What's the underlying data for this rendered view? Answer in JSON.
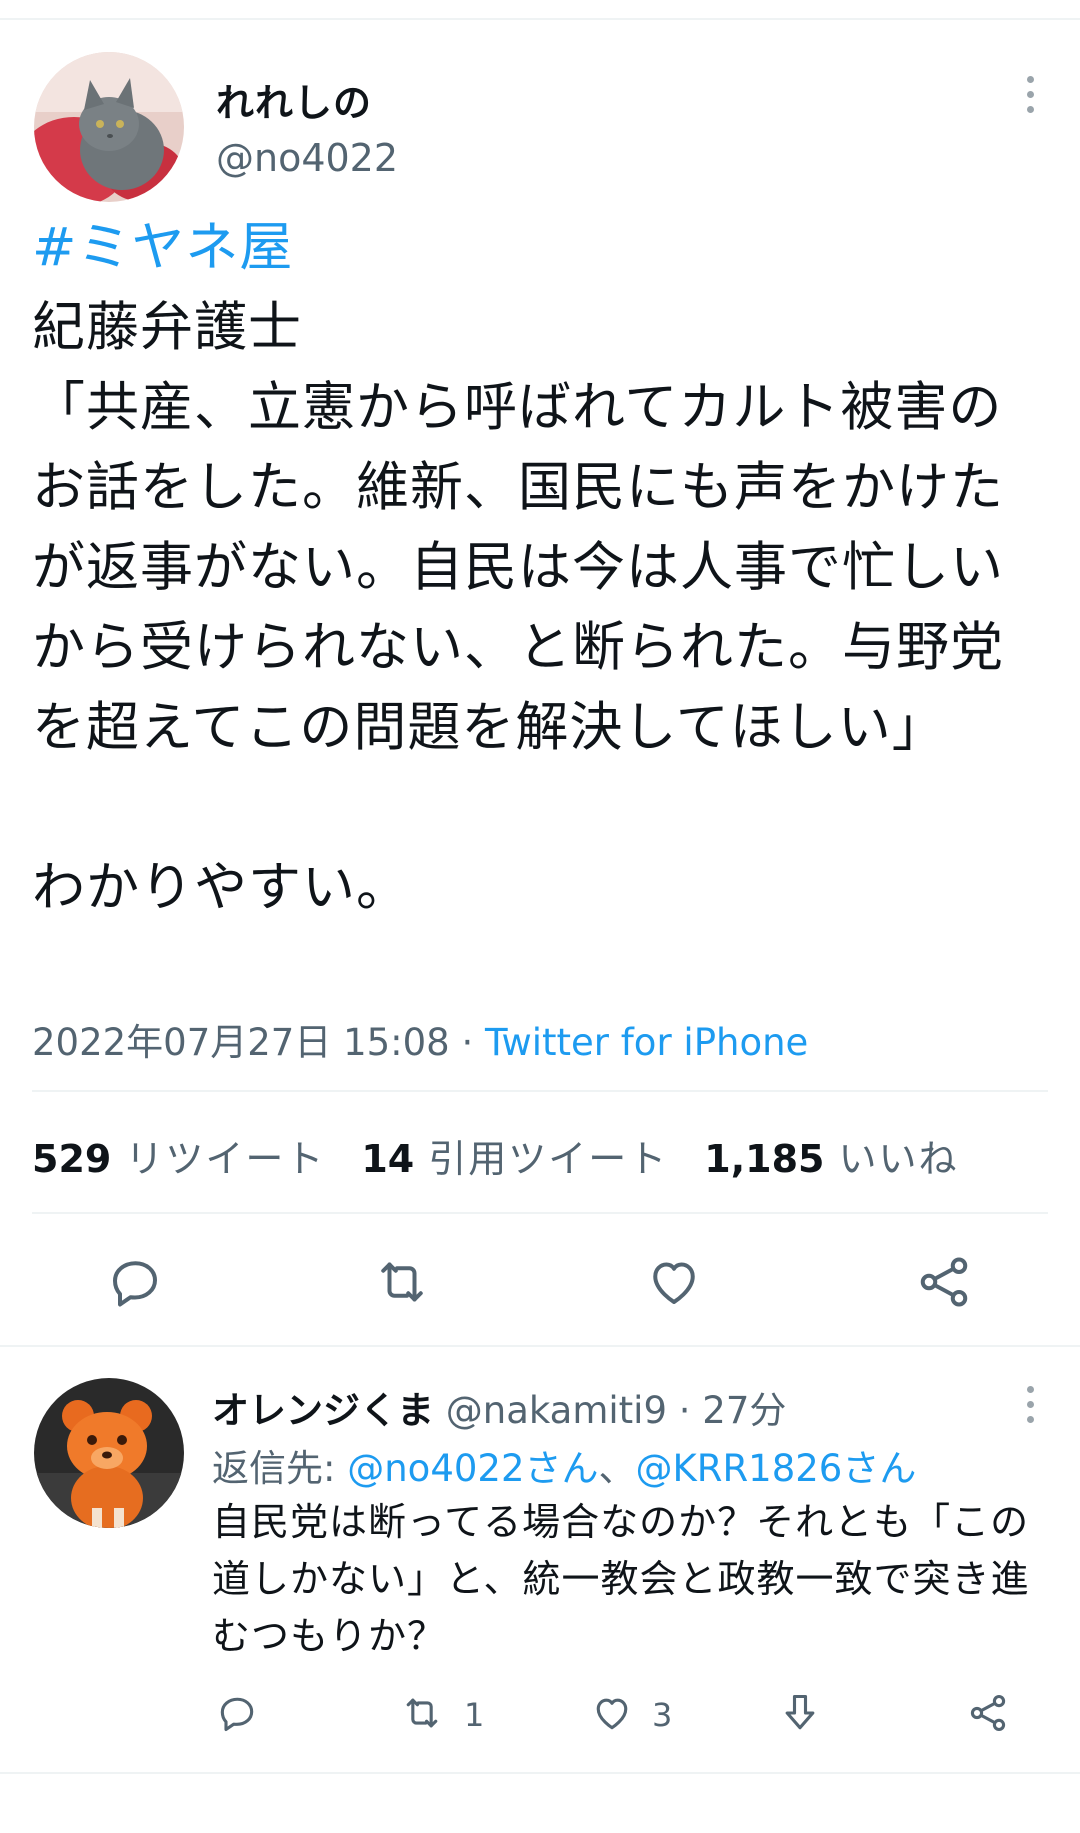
{
  "tweet": {
    "display_name": "れれしの",
    "handle": "@no4022",
    "hashtag": "#ミヤネ屋",
    "body": "紀藤弁護士\n「共産、立憲から呼ばれてカルト被害のお話をした。維新、国民にも声をかけたが返事がない。自民は今は人事で忙しいから受けられない、と断られた。与野党を超えてこの問題を解決してほしい」\n\nわかりやすい。",
    "timestamp": "2022年07月27日 15:08",
    "separator": " · ",
    "source": "Twitter for iPhone",
    "stats": {
      "retweets_count": "529",
      "retweets_label": "リツイート",
      "quotes_count": "14",
      "quotes_label": "引用ツイート",
      "likes_count": "1,185",
      "likes_label": "いいね"
    },
    "icons": [
      "reply-icon",
      "retweet-icon",
      "like-icon",
      "share-icon"
    ]
  },
  "reply": {
    "display_name": "オレンジくま",
    "handle": "@nakamiti9",
    "separator": " · ",
    "time": "27分",
    "reply_to_label": "返信先: ",
    "mention_1": "@no4022さん",
    "mention_sep": "、",
    "mention_2": "@KRR1826さん",
    "body": "自民党は断ってる場合なのか？それとも「この道しかない」と、統一教会と政教一致で突き進むつもりか？",
    "retweet_count": "1",
    "like_count": "3",
    "icons": [
      "reply-icon",
      "retweet-icon",
      "like-icon",
      "vote-down-icon",
      "share-icon"
    ]
  },
  "colors": {
    "accent": "#1d9bf0",
    "secondary_text": "#536471",
    "divider": "#eff3f4"
  }
}
